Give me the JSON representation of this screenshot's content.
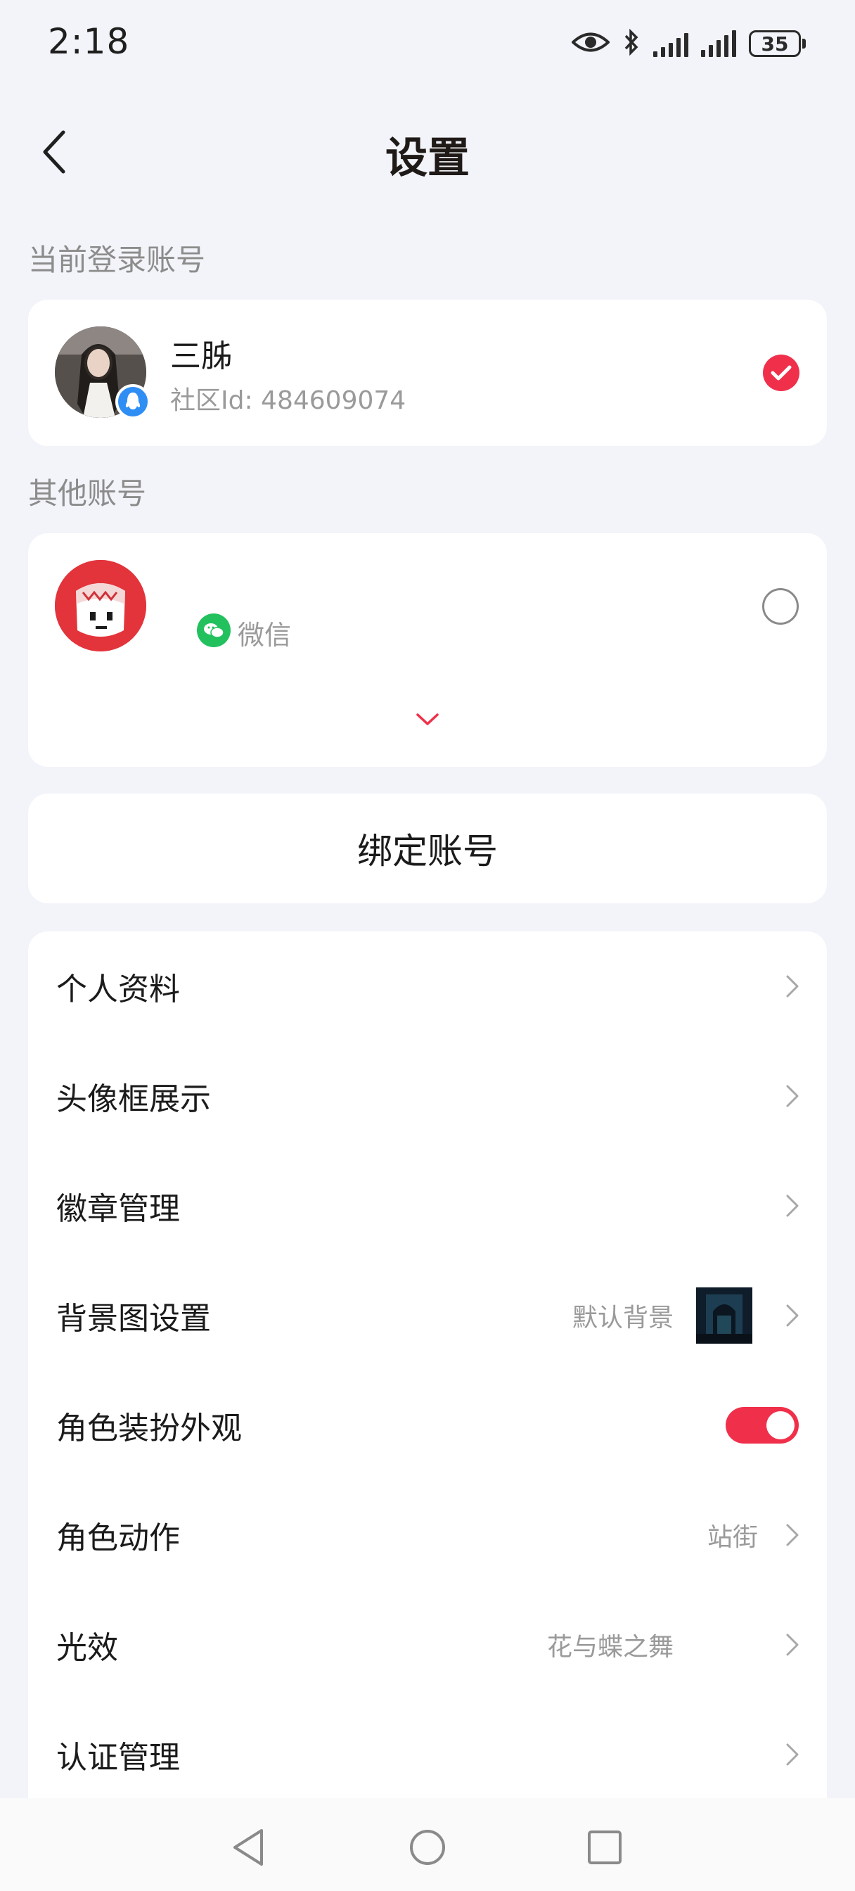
{
  "status_bar": {
    "time": "2:18",
    "battery": "35",
    "icons": [
      "eye-icon",
      "bluetooth-icon",
      "signal-icon",
      "signal-icon"
    ]
  },
  "header": {
    "title": "设置",
    "back_icon": "chevron-left-icon"
  },
  "current_account": {
    "section_label": "当前登录账号",
    "name": "三胏",
    "id_text": "社区Id: 484609074",
    "selected": true
  },
  "other_accounts": {
    "section_label": "其他账号",
    "items": [
      {
        "platform": "微信",
        "platform_icon": "wechat-icon",
        "selected": false
      }
    ],
    "expand_icon": "chevron-down-icon"
  },
  "bind_button": {
    "label": "绑定账号"
  },
  "settings": [
    {
      "label": "个人资料",
      "value": ""
    },
    {
      "label": "头像框展示",
      "value": ""
    },
    {
      "label": "徽章管理",
      "value": ""
    },
    {
      "label": "背景图设置",
      "value": "默认背景"
    },
    {
      "label": "角色装扮外观",
      "value": "",
      "toggle": true
    },
    {
      "label": "角色动作",
      "value": "站街"
    },
    {
      "label": "光效",
      "value": "花与蝶之舞"
    },
    {
      "label": "认证管理",
      "value": ""
    }
  ],
  "colors": {
    "accent": "#f0304a",
    "background": "#f3f4f9",
    "card": "#ffffff"
  }
}
